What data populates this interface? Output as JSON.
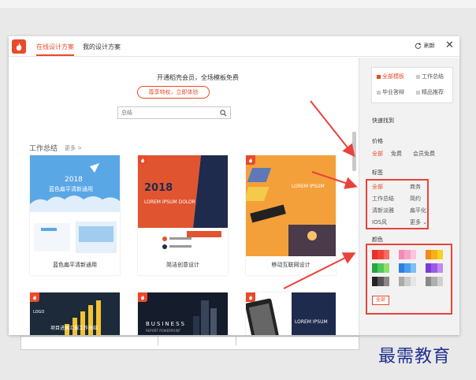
{
  "tabs": {
    "online": "在线设计方案",
    "mine": "我的设计方案"
  },
  "header": {
    "refresh_label": "刷新",
    "close_glyph": "✕"
  },
  "promo": {
    "text": "开通稻壳会员，全场模板免费",
    "button": "尊享特权，立即体验"
  },
  "search": {
    "placeholder": "总结"
  },
  "section": {
    "title": "工作总结",
    "more": "更多 >"
  },
  "cards": [
    {
      "label": "蓝色扁平清新通用",
      "thumb_year": "2018",
      "thumb_title": "蓝色扁平清新通用"
    },
    {
      "label": "简洁创意设计",
      "thumb_year": "2018",
      "thumb_title": "LOREM IPSUM DOLOR"
    },
    {
      "label": "移动互联网设计",
      "thumb_title": "LOREM IPSUM"
    }
  ],
  "cards_row2": [
    {
      "thumb_title": "项目进展汇报工作总结",
      "thumb_sub": "LOGO"
    },
    {
      "thumb_title": "BUSINESS",
      "thumb_sub": "REPORT POWERPOINT"
    },
    {
      "thumb_title": "LOREM IPSUM"
    }
  ],
  "sidebar": {
    "categories": [
      "全部模板",
      "工作总结",
      "毕业答辩",
      "精品推荐"
    ],
    "quick_find": "快速找到",
    "price_label": "价格",
    "prices": [
      "全部",
      "免费",
      "会员免费"
    ],
    "tag_label": "标签",
    "tags": [
      "全部",
      "商务",
      "工作总结",
      "简约",
      "清新淡雅",
      "扁平化",
      "IOS风",
      "更多"
    ],
    "color_label": "颜色",
    "color_all": "全部"
  },
  "colors": {
    "accent": "#e94a2a",
    "swatches": [
      [
        "#e8302a",
        "#f04438",
        "#ff6b5c"
      ],
      [
        "#f28ab8",
        "#f6a4c6",
        "#fbc6dc"
      ],
      [
        "#f08a18",
        "#f5b01a",
        "#f7d21e"
      ],
      [
        "#26a541",
        "#4cc95b",
        "#8fe06b"
      ],
      [
        "#2e7fe0",
        "#4a9ff0",
        "#7ebff7"
      ],
      [
        "#7a3cd6",
        "#9a5ce6",
        "#c08af0"
      ],
      [
        "#222222",
        "#555555",
        "#888888"
      ],
      [
        "#aaaaaa",
        "#cccccc",
        "#e6e6e6"
      ],
      [
        "#8a8a8a",
        "#b0b0b0",
        "#d0d0d0"
      ]
    ]
  },
  "watermark": "最需教育"
}
